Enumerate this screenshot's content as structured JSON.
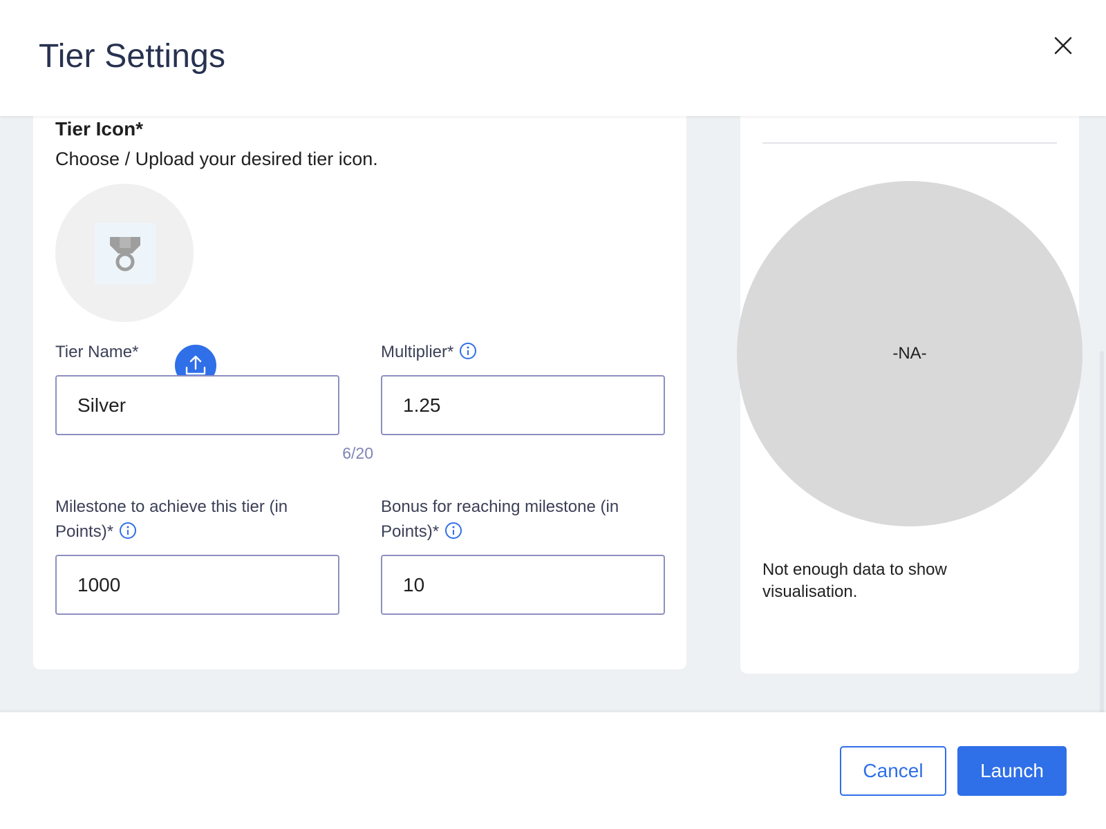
{
  "header": {
    "title": "Tier Settings",
    "close_icon": "close-icon"
  },
  "tier_icon": {
    "label": "Tier Icon*",
    "description": "Choose / Upload your desired tier icon.",
    "preview_icon": "medal-icon",
    "upload_icon": "upload-icon"
  },
  "fields": {
    "tier_name": {
      "label": "Tier Name*",
      "value": "Silver",
      "counter": "6/20"
    },
    "multiplier": {
      "label": "Multiplier*",
      "value": "1.25",
      "info_icon": "info-icon"
    },
    "milestone": {
      "label_line1": "Milestone to achieve this tier (in",
      "label_line2": "Points)*",
      "value": "1000",
      "info_icon": "info-icon"
    },
    "bonus": {
      "label_line1": "Bonus for reaching milestone (in",
      "label_line2": "Points)*",
      "value": "10",
      "info_icon": "info-icon"
    }
  },
  "visualisation": {
    "placeholder": "-NA-",
    "message": "Not enough data to show visualisation."
  },
  "footer": {
    "cancel_label": "Cancel",
    "launch_label": "Launch"
  },
  "colors": {
    "primary": "#2f6fe8",
    "title": "#273150",
    "input_border": "#8d8fc0",
    "background": "#edf1f4",
    "na_circle": "#d9d9d9"
  }
}
